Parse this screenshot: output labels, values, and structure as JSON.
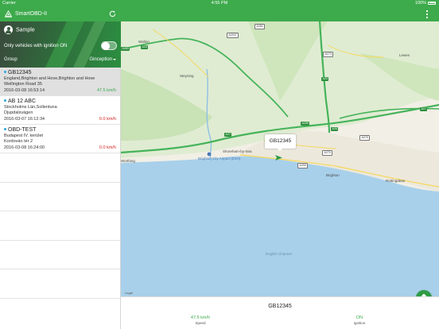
{
  "status_bar": {
    "carrier": "Carrier",
    "time": "4:55 PM",
    "battery": "100%"
  },
  "app": {
    "title": "SmartOBD-II"
  },
  "sidebar": {
    "user": "Sample",
    "ignition_label": "Only vehicles with ignition ON",
    "ignition_on": false,
    "group_label": "Group",
    "group_value": "Ginception"
  },
  "vehicles": [
    {
      "plate": "GB12345",
      "address1": "England,Brighton and Hove,Brighton and Hove",
      "address2": "Wellington Road 35",
      "time": "2016-03-08 16:53:14",
      "speed": "47.5 km/h",
      "moving": true
    },
    {
      "plate": "AB 12 ABC",
      "address1": "Stockholms Län,Sollentuna",
      "address2": "Djupdalsvägen",
      "time": "2016-03-07 16:12:34",
      "speed": "0.0 km/h",
      "moving": false
    },
    {
      "plate": "OBD-TEST",
      "address1": "Budapest IV. kerület",
      "address2": "Kordován tér 2",
      "time": "2016-03-08 16:24:00",
      "speed": "0.0 km/h",
      "moving": false
    }
  ],
  "map": {
    "callout": "GB12345",
    "legal": "Legal",
    "places": [
      "Walton",
      "Steyning",
      "Shoreham-by-Sea",
      "Brighton City Airport (ESH)",
      "Brighton",
      "Rottingdean",
      "Worthing",
      "English Channel",
      "Lewes"
    ],
    "roads": [
      "A283",
      "A2037",
      "A27",
      "A24",
      "A281",
      "A273",
      "A23",
      "A270",
      "A259",
      "A27",
      "A26",
      "A259",
      "A270"
    ]
  },
  "detail": {
    "plate": "GB12345",
    "speed_value": "47.5 km/h",
    "speed_label": "Speed",
    "ignition_value": "ON",
    "ignition_label": "Ignition"
  },
  "colors": {
    "primary": "#3daa4c",
    "stopped": "#d42020",
    "sea": "#a8d0ea",
    "land": "#f2efe6",
    "green_area": "#cfe6bd"
  },
  "icons": {
    "refresh": "refresh-icon",
    "menu": "more-vert-icon",
    "directions": "directions-icon",
    "user": "account-icon",
    "app": "app-logo-icon"
  }
}
